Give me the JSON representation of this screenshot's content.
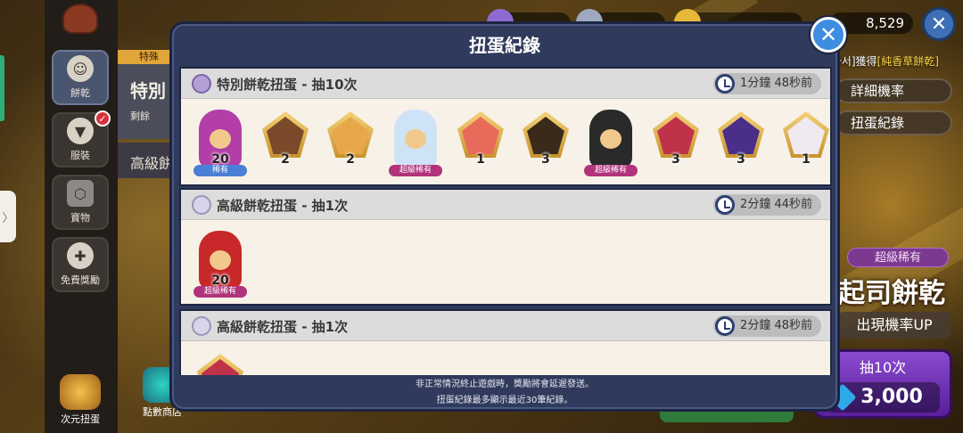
{
  "sidebar": {
    "items": [
      {
        "label": "餅乾"
      },
      {
        "label": "服裝"
      },
      {
        "label": "寶物"
      },
      {
        "label": "免費獎勵"
      }
    ],
    "bottom_label": "次元扭蛋"
  },
  "background": {
    "peek_tag": "特殊",
    "peek_title": "特別",
    "peek_sub": "剩餘",
    "peek_row2": "高級餅",
    "shop_label": "點數商店",
    "currency_right": "8,529",
    "obtained_note_prefix": "[소멕마서]獲得",
    "obtained_note_highlight": "[純香草餅乾]",
    "detail_rate_label": "詳細機率",
    "record_label": "扭蛋紀錄",
    "rare_tag": "超級稀有",
    "featured_name": "起司餅乾",
    "rate_up_label": "出現機率UP",
    "draw_label": "抽10次",
    "draw_cost": "3,000"
  },
  "modal": {
    "title": "扭蛋紀錄",
    "footer_line1": "非正常情況終止遊戲時，獎勵將會延遲發送。",
    "footer_line2": "扭蛋紀錄最多顯示最近30筆紀錄。",
    "entries": [
      {
        "title": "特別餅乾扭蛋 - 抽10次",
        "time": "1分鐘 48秒前",
        "icon": "special-gacha-icon",
        "items": [
          {
            "type": "cookie",
            "count": "20",
            "rarity": "稀有",
            "color": "#b33ea8"
          },
          {
            "type": "soulstone",
            "count": "2",
            "color": "#7a4a2a"
          },
          {
            "type": "soulstone",
            "count": "2",
            "color": "#e8a84a"
          },
          {
            "type": "cookie",
            "count": "",
            "rarity": "超級稀有",
            "color": "#cfe3f6"
          },
          {
            "type": "soulstone",
            "count": "1",
            "color": "#e86a5a"
          },
          {
            "type": "soulstone",
            "count": "3",
            "color": "#3a2a1a"
          },
          {
            "type": "cookie",
            "count": "",
            "rarity": "超級稀有",
            "color": "#2a2a2a"
          },
          {
            "type": "soulstone",
            "count": "3",
            "color": "#c0324a"
          },
          {
            "type": "soulstone",
            "count": "3",
            "color": "#4a2e8a"
          },
          {
            "type": "soulstone",
            "count": "1",
            "color": "#f0eaf0"
          }
        ]
      },
      {
        "title": "高級餅乾扭蛋 - 抽1次",
        "time": "2分鐘 44秒前",
        "icon": "premium-gacha-icon",
        "items": [
          {
            "type": "cookie",
            "count": "20",
            "rarity": "超級稀有",
            "color": "#c8282a"
          }
        ]
      },
      {
        "title": "高級餅乾扭蛋 - 抽1次",
        "time": "2分鐘 48秒前",
        "icon": "premium-gacha-icon",
        "items": [
          {
            "type": "soulstone",
            "count": "",
            "color": "#c0324a"
          }
        ]
      }
    ]
  },
  "colors": {
    "modal_bg": "#2f3a5c",
    "entry_bg": "#f7f1e7",
    "close_blue": "#3d8de0",
    "rare_blue": "#4a7fd6",
    "epic_pink": "#b0337c"
  }
}
